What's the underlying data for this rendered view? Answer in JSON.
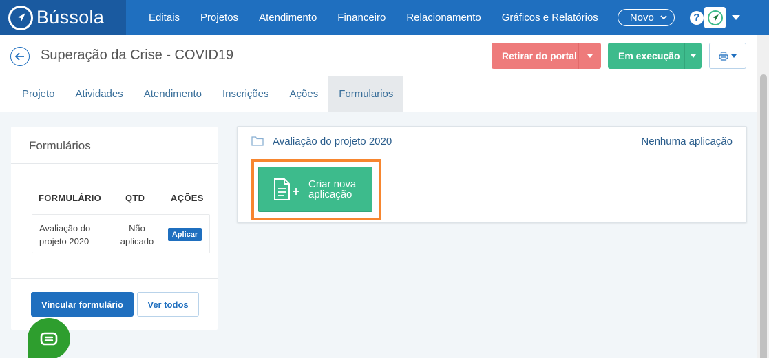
{
  "brand": {
    "name": "Bússola"
  },
  "nav": {
    "items": [
      "Editais",
      "Projetos",
      "Atendimento",
      "Financeiro",
      "Relacionamento",
      "Gráficos e Relatórios"
    ],
    "new_label": "Novo",
    "help_label": "?"
  },
  "header": {
    "title": "Superação da Crise - COVID19",
    "withdraw_label": "Retirar do portal",
    "status_label": "Em execução"
  },
  "tabs": [
    "Projeto",
    "Atividades",
    "Atendimento",
    "Inscrições",
    "Ações",
    "Formularios"
  ],
  "active_tab": "Formularios",
  "left_panel": {
    "title": "Formulários",
    "columns": [
      "FORMULÁRIO",
      "QTD",
      "AÇÕES"
    ],
    "rows": [
      {
        "name": "Avaliação do projeto 2020",
        "qtd": "Não aplicado",
        "action": "Aplicar"
      }
    ],
    "link_button": "Vincular formulário",
    "view_all_button": "Ver todos"
  },
  "form_card": {
    "title": "Avaliação do projeto 2020",
    "status": "Nenhuma aplicação",
    "create_button": "Criar nova aplicação"
  },
  "colors": {
    "primary": "#1f6fbf",
    "danger": "#ee7b7b",
    "success": "#3dbb8c",
    "highlight": "#f7862f",
    "chat": "#2e9e2e"
  }
}
